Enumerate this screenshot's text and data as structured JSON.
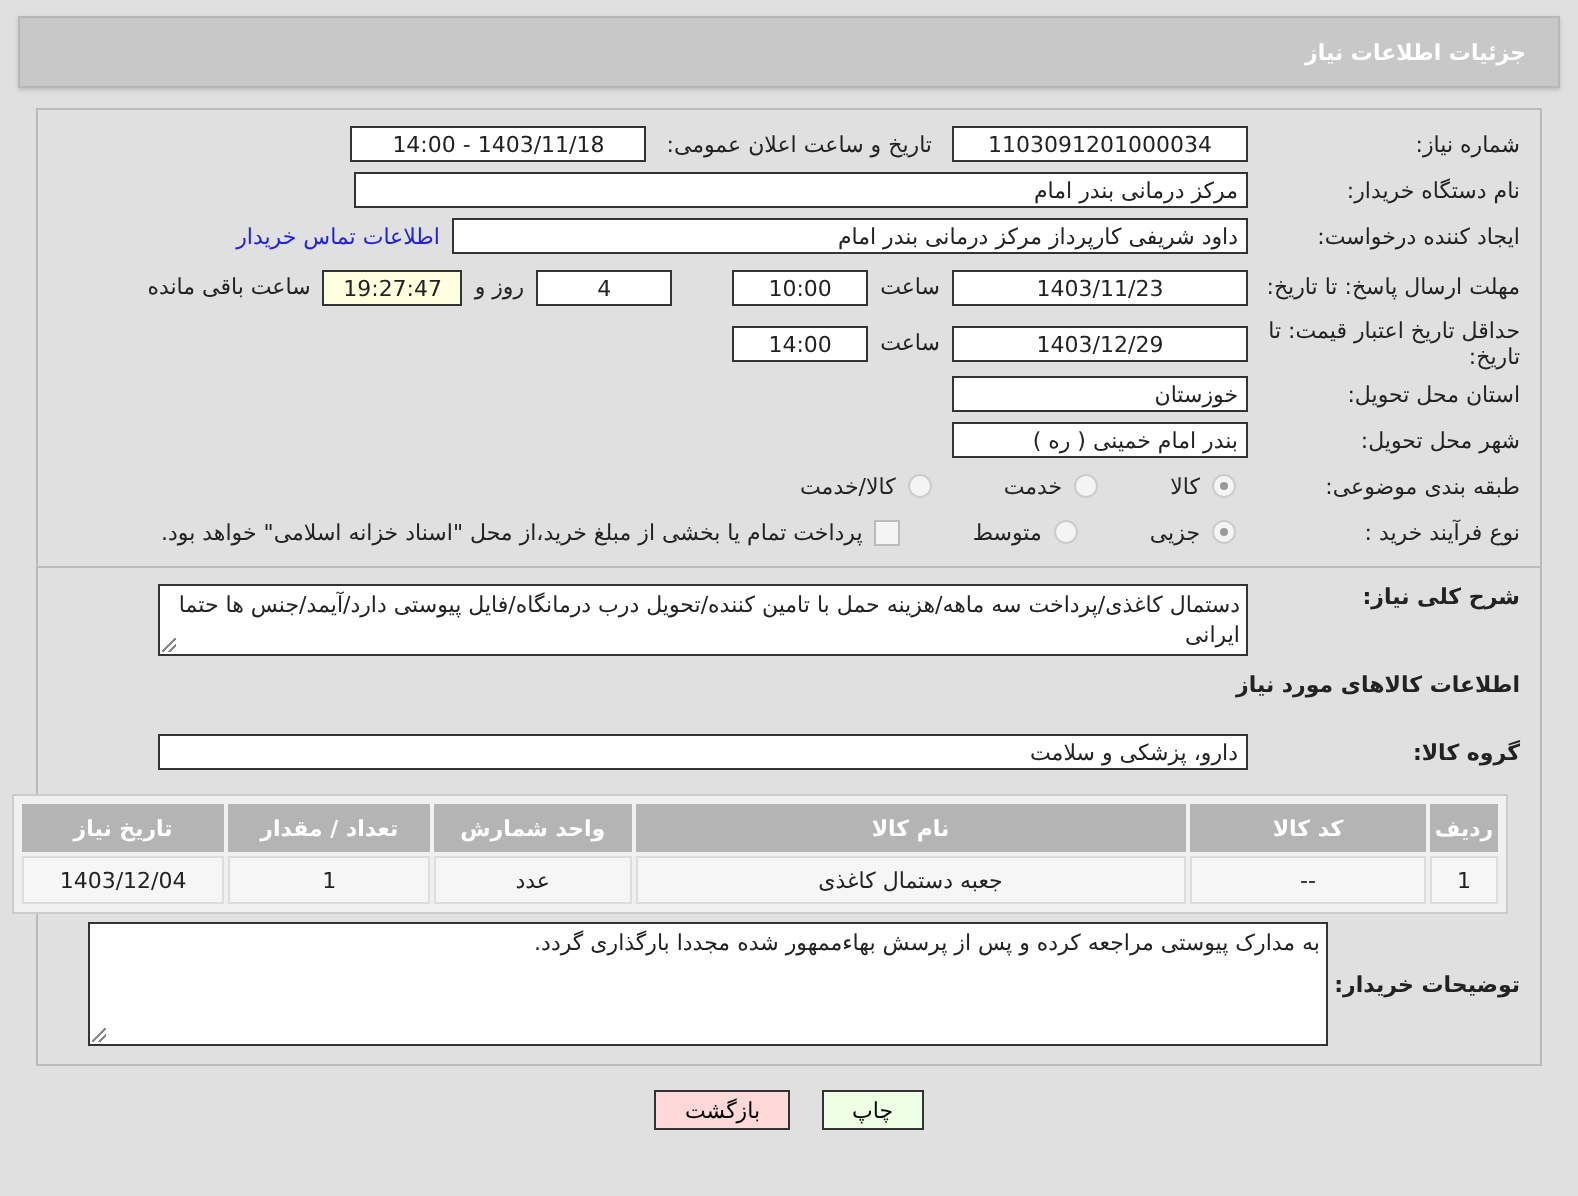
{
  "header": {
    "title": "جزئیات اطلاعات نیاز"
  },
  "need_number": {
    "label": "شماره نیاز:",
    "value": "1103091201000034"
  },
  "announce": {
    "label": "تاریخ و ساعت اعلان عمومی:",
    "value": "1403/11/18 - 14:00"
  },
  "buyer_org": {
    "label": "نام دستگاه خریدار:",
    "value": "مرکز درمانی بندر امام"
  },
  "requester": {
    "label": "ایجاد کننده درخواست:",
    "value": "داود شریفی کارپرداز مرکز درمانی بندر امام",
    "link": "اطلاعات تماس خریدار"
  },
  "deadline": {
    "label": "مهلت ارسال پاسخ: تا تاریخ:",
    "date": "1403/11/23",
    "time_label": "ساعت",
    "time": "10:00",
    "days": "4",
    "days_label": "روز و",
    "remaining": "19:27:47",
    "remaining_label": "ساعت باقی مانده"
  },
  "validity": {
    "label": "حداقل تاریخ اعتبار قیمت: تا تاریخ:",
    "date": "1403/12/29",
    "time_label": "ساعت",
    "time": "14:00"
  },
  "province": {
    "label": "استان محل تحویل:",
    "value": "خوزستان"
  },
  "city": {
    "label": "شهر محل تحویل:",
    "value": "بندر امام خمینی ( ره )"
  },
  "category": {
    "label": "طبقه بندی موضوعی:",
    "options": [
      {
        "label": "کالا",
        "selected": true
      },
      {
        "label": "خدمت",
        "selected": false
      },
      {
        "label": "کالا/خدمت",
        "selected": false
      }
    ]
  },
  "process": {
    "label": "نوع فرآیند خرید :",
    "options": [
      {
        "label": "جزیی",
        "selected": true
      },
      {
        "label": "متوسط",
        "selected": false
      }
    ],
    "treasury": {
      "label": "پرداخت تمام یا بخشی از مبلغ خرید،از محل \"اسناد خزانه اسلامی\" خواهد بود.",
      "checked": false
    }
  },
  "description": {
    "label": "شرح کلی نیاز:",
    "value": "دستمال کاغذی/پرداخت سه ماهه/هزینه حمل با تامین کننده/تحویل درب درمانگاه/فایل پیوستی دارد/آیمد/جنس ها حتما ایرانی"
  },
  "goods_section": {
    "title": "اطلاعات کالاهای مورد نیاز"
  },
  "goods_group": {
    "label": "گروه کالا:",
    "value": "دارو، پزشکی و سلامت"
  },
  "table": {
    "columns": [
      "ردیف",
      "کد کالا",
      "نام کالا",
      "واحد شمارش",
      "تعداد / مقدار",
      "تاریخ نیاز"
    ],
    "rows": [
      [
        "1",
        "--",
        "جعبه دستمال کاغذی",
        "عدد",
        "1",
        "1403/12/04"
      ]
    ]
  },
  "buyer_notes": {
    "label": "توضیحات خریدار:",
    "value": "به مدارک پیوستی مراجعه کرده و پس از پرسش بهاءممهور شده مجددا بارگذاری گردد."
  },
  "buttons": [
    {
      "label": "چاپ",
      "kind": "print"
    },
    {
      "label": "بازگشت",
      "kind": "back"
    }
  ]
}
